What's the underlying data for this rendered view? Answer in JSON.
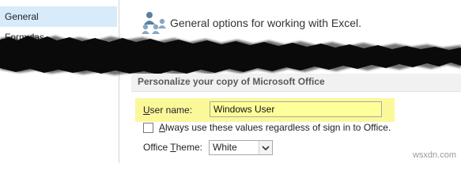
{
  "sidebar": {
    "items": [
      {
        "label": "General",
        "selected": true
      },
      {
        "label": "Formulas",
        "selected": false
      }
    ]
  },
  "header": {
    "icon": "people-options-icon",
    "title": "General options for working with Excel."
  },
  "section": {
    "title": "Personalize your copy of Microsoft Office"
  },
  "user_name": {
    "label": "User name:",
    "mnemonic": "U",
    "label_rest": "ser name:",
    "value": "Windows User",
    "highlight_color": "#fbf89a"
  },
  "always_use": {
    "checked": false,
    "mnemonic": "A",
    "label_rest": "lways use these values regardless of sign in to Office."
  },
  "office_theme": {
    "label_pre": "Office ",
    "mnemonic": "T",
    "label_post": "heme:",
    "selected": "White"
  },
  "watermark": "wsxdn.com",
  "colors": {
    "selection": "#d7ebfa",
    "section_band": "#f1f1f1"
  }
}
